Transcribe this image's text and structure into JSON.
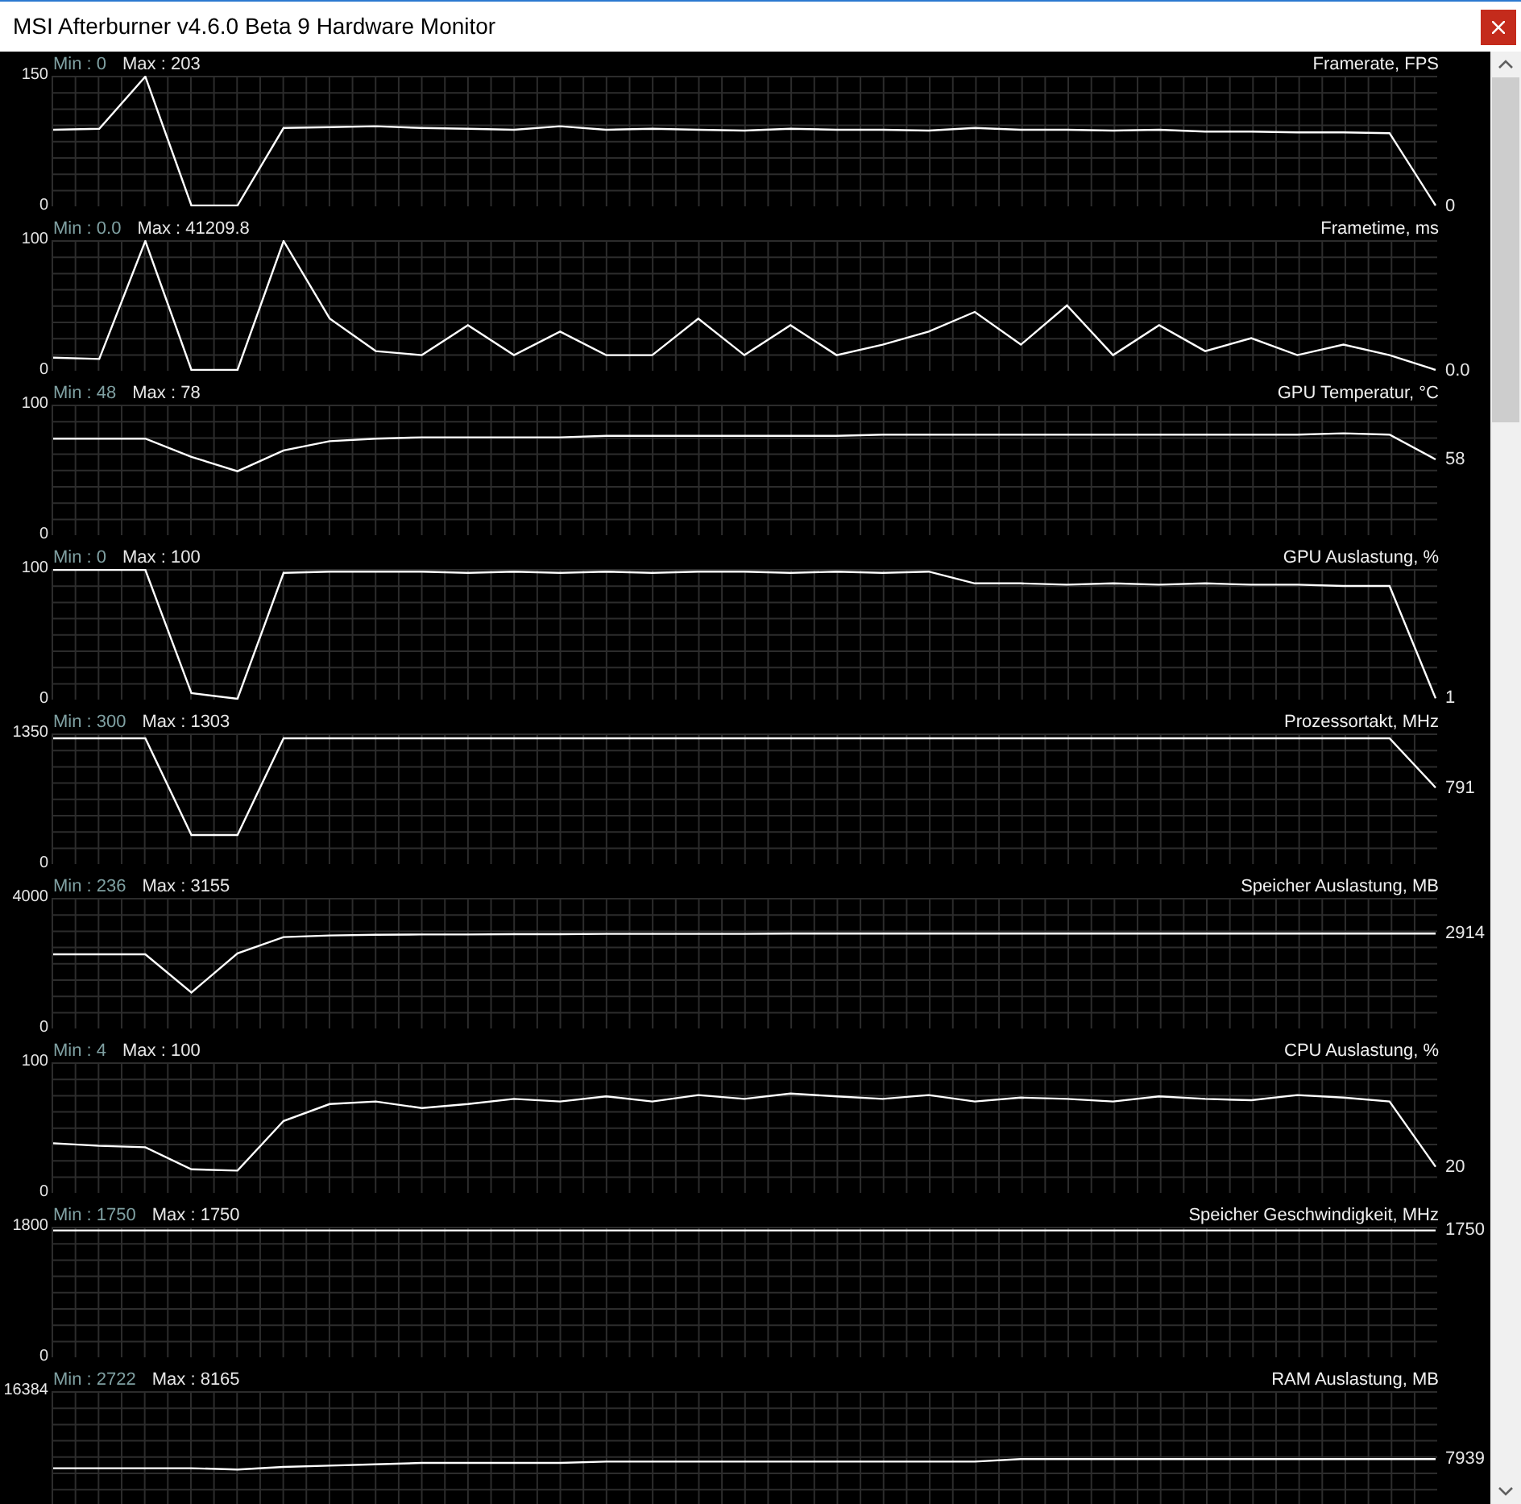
{
  "window": {
    "title": "MSI Afterburner v4.6.0 Beta 9 Hardware Monitor"
  },
  "graphs": [
    {
      "min": "Min : 0",
      "max": "Max : 203",
      "title": "Framerate, FPS",
      "current": "0",
      "chart_data": {
        "type": "line",
        "grid": true,
        "ylim": [
          0,
          150
        ],
        "yticks": [
          0,
          150
        ],
        "series": [
          {
            "color": "#ffffff",
            "values": [
              88,
              89,
              150,
              0,
              0,
              90,
              91,
              92,
              90,
              89,
              88,
              92,
              88,
              89,
              88,
              87,
              89,
              88,
              88,
              87,
              90,
              88,
              88,
              87,
              88,
              86,
              86,
              85,
              85,
              84,
              0
            ]
          }
        ]
      }
    },
    {
      "min": "Min : 0.0",
      "max": "Max : 41209.8",
      "title": "Frametime, ms",
      "current": "0.0",
      "chart_data": {
        "type": "line",
        "grid": true,
        "ylim": [
          0,
          100
        ],
        "yticks": [
          0,
          100
        ],
        "series": [
          {
            "color": "#ffffff",
            "values": [
              10,
              9,
              100,
              0,
              0,
              100,
              40,
              15,
              12,
              35,
              12,
              30,
              12,
              12,
              40,
              12,
              35,
              12,
              20,
              30,
              45,
              20,
              50,
              12,
              35,
              15,
              25,
              12,
              20,
              12,
              0
            ]
          }
        ]
      }
    },
    {
      "min": "Min : 48",
      "max": "Max : 78",
      "title": "GPU Temperatur, °C",
      "current": "58",
      "chart_data": {
        "type": "line",
        "grid": true,
        "ylim": [
          0,
          100
        ],
        "yticks": [
          0,
          100
        ],
        "series": [
          {
            "color": "#ffffff",
            "values": [
              74,
              74,
              74,
              60,
              49,
              65,
              72,
              74,
              75,
              75,
              75,
              75,
              76,
              76,
              76,
              76,
              76,
              76,
              77,
              77,
              77,
              77,
              77,
              77,
              77,
              77,
              77,
              77,
              78,
              77,
              58
            ]
          }
        ]
      }
    },
    {
      "min": "Min : 0",
      "max": "Max : 100",
      "title": "GPU Auslastung, %",
      "current": "1",
      "chart_data": {
        "type": "line",
        "grid": true,
        "ylim": [
          0,
          100
        ],
        "yticks": [
          0,
          100
        ],
        "series": [
          {
            "color": "#ffffff",
            "values": [
              100,
              100,
              100,
              5,
              0,
              97,
              98,
              98,
              98,
              97,
              98,
              97,
              98,
              97,
              98,
              98,
              97,
              98,
              97,
              98,
              89,
              89,
              88,
              89,
              88,
              89,
              88,
              88,
              87,
              87,
              1
            ]
          }
        ]
      }
    },
    {
      "min": "Min : 300",
      "max": "Max : 1303",
      "title": "Prozessortakt, MHz",
      "current": "791",
      "chart_data": {
        "type": "line",
        "grid": true,
        "ylim": [
          0,
          1350
        ],
        "yticks": [
          0,
          1350
        ],
        "series": [
          {
            "color": "#ffffff",
            "values": [
              1300,
              1300,
              1300,
              300,
              300,
              1300,
              1300,
              1300,
              1300,
              1300,
              1300,
              1300,
              1300,
              1300,
              1300,
              1300,
              1300,
              1300,
              1300,
              1300,
              1300,
              1300,
              1300,
              1300,
              1300,
              1300,
              1300,
              1300,
              1300,
              1300,
              790
            ]
          }
        ]
      }
    },
    {
      "min": "Min : 236",
      "max": "Max : 3155",
      "title": "Speicher Auslastung, MB",
      "current": "2914",
      "chart_data": {
        "type": "line",
        "grid": true,
        "ylim": [
          0,
          4000
        ],
        "yticks": [
          0,
          4000
        ],
        "series": [
          {
            "color": "#ffffff",
            "values": [
              2270,
              2270,
              2270,
              1100,
              2300,
              2800,
              2850,
              2870,
              2880,
              2880,
              2890,
              2890,
              2900,
              2900,
              2900,
              2900,
              2910,
              2910,
              2910,
              2910,
              2910,
              2910,
              2910,
              2910,
              2910,
              2910,
              2910,
              2910,
              2910,
              2910,
              2910
            ]
          }
        ]
      }
    },
    {
      "min": "Min : 4",
      "max": "Max : 100",
      "title": "CPU Auslastung, %",
      "current": "20",
      "chart_data": {
        "type": "line",
        "grid": true,
        "ylim": [
          0,
          100
        ],
        "yticks": [
          0,
          100
        ],
        "series": [
          {
            "color": "#ffffff",
            "values": [
              38,
              36,
              35,
              18,
              17,
              55,
              68,
              70,
              65,
              68,
              72,
              70,
              74,
              70,
              75,
              72,
              76,
              74,
              72,
              75,
              70,
              73,
              72,
              70,
              74,
              72,
              71,
              75,
              73,
              70,
              20
            ]
          }
        ]
      }
    },
    {
      "min": "Min : 1750",
      "max": "Max : 1750",
      "title": "Speicher Geschwindigkeit, MHz",
      "current": "1750",
      "chart_data": {
        "type": "line",
        "grid": true,
        "ylim": [
          0,
          1800
        ],
        "yticks": [
          0,
          1800
        ],
        "series": [
          {
            "color": "#ffffff",
            "values": [
              1750,
              1750,
              1750,
              1750,
              1750,
              1750,
              1750,
              1750,
              1750,
              1750,
              1750,
              1750,
              1750,
              1750,
              1750,
              1750,
              1750,
              1750,
              1750,
              1750,
              1750,
              1750,
              1750,
              1750,
              1750,
              1750,
              1750,
              1750,
              1750,
              1750,
              1750
            ]
          }
        ]
      }
    },
    {
      "min": "Min : 2722",
      "max": "Max : 8165",
      "title": "RAM Auslastung, MB",
      "current": "7939",
      "scale_label": "16384"
    }
  ]
}
